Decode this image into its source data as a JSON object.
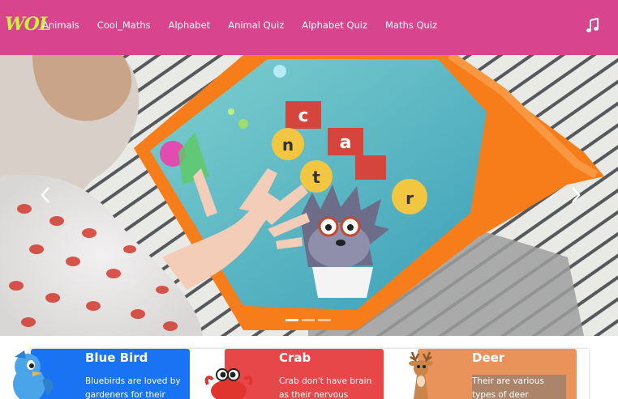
{
  "brand": {
    "logo_text": "WOL"
  },
  "nav": {
    "items": [
      {
        "label": "Animals"
      },
      {
        "label": "Cool_Maths"
      },
      {
        "label": "Alphabet"
      },
      {
        "label": "Animal Quiz"
      },
      {
        "label": "Alphabet Quiz"
      },
      {
        "label": "Maths Quiz"
      }
    ],
    "music_icon": "music-note-icon"
  },
  "hero": {
    "tablet_letters": [
      "c",
      "a",
      "n",
      "t",
      "r"
    ],
    "indicators": {
      "count": 3,
      "active": 0
    }
  },
  "cards": [
    {
      "title": "Blue Bird",
      "description": "Bluebirds are loved by gardeners for their insect",
      "color": "#1a73f2",
      "icon": "bluebird-icon"
    },
    {
      "title": "Crab",
      "description": "Crab don't have brain as their nervous system",
      "color": "#e8474a",
      "icon": "crab-icon"
    },
    {
      "title": "Deer",
      "description": "Their are various types of deer",
      "color": "#e9925a",
      "icon": "deer-icon"
    }
  ],
  "colors": {
    "navbar": "#d9448f",
    "brand": "#c9f03a",
    "tablet_frame": "#f77c1a"
  }
}
